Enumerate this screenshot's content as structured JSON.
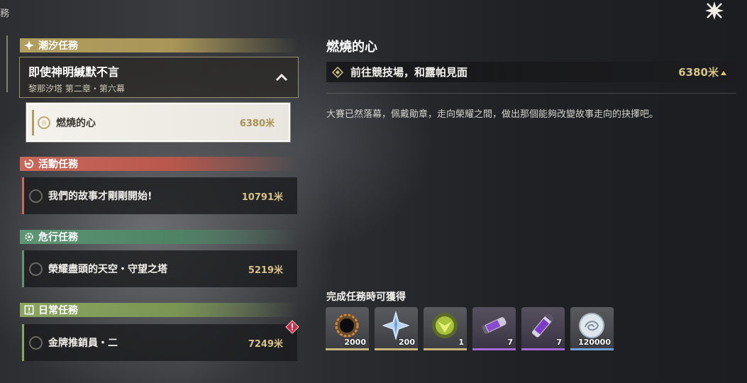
{
  "header": {
    "corner_char": "務"
  },
  "categories": {
    "tide": {
      "label": "潮汐任務",
      "main_quest": {
        "title": "即使神明緘默不言",
        "subtitle": "黎那汐塔 第二章・第六幕"
      },
      "sub_quest": {
        "label": "燃燒的心",
        "distance": "6380米"
      }
    },
    "event": {
      "label": "活動任務",
      "quest": {
        "label": "我們的故事才剛剛開始!",
        "distance": "10791米"
      }
    },
    "danger": {
      "label": "危行任務",
      "quest": {
        "label": "榮耀盡頭的天空・守望之塔",
        "distance": "5219米"
      }
    },
    "daily": {
      "label": "日常任務",
      "quest": {
        "label": "金牌推銷員・二",
        "distance": "7249米"
      }
    }
  },
  "detail": {
    "title": "燃燒的心",
    "objective": {
      "text": "前往競技場，和露帕見面",
      "distance": "6380米"
    },
    "description": "大賽已然落幕，佩戴勛章，走向榮耀之間，做出那個能夠改變故事走向的抉擇吧。"
  },
  "rewards": {
    "title": "完成任務時可獲得",
    "items": [
      {
        "icon": "dark-ring-icon",
        "count": "2000"
      },
      {
        "icon": "crystal-star-icon",
        "count": "200"
      },
      {
        "icon": "green-emblem-icon",
        "count": "1"
      },
      {
        "icon": "purple-tube-icon",
        "count": "7"
      },
      {
        "icon": "purple-vial-icon",
        "count": "7"
      },
      {
        "icon": "silver-coin-icon",
        "count": "120000"
      }
    ]
  },
  "colors": {
    "tide": "#b29e5e",
    "event": "#c9685b",
    "danger": "#5e9574",
    "daily": "#8aa561",
    "distance": "#d8c48a"
  }
}
